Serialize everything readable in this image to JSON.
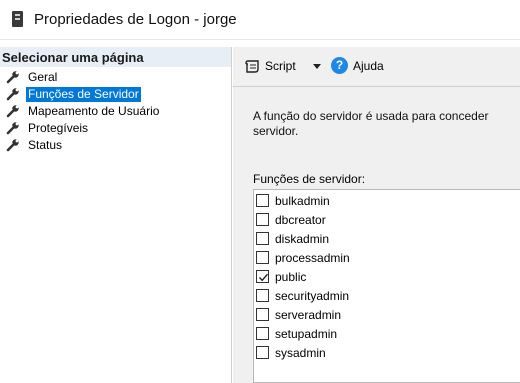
{
  "window": {
    "title": "Propriedades de Logon - jorge",
    "icon": "server-icon"
  },
  "sidebar": {
    "heading": "Selecionar uma página",
    "items": [
      {
        "label": "Geral",
        "icon": "wrench-icon",
        "selected": false
      },
      {
        "label": "Funções de Servidor",
        "icon": "wrench-icon",
        "selected": true
      },
      {
        "label": "Mapeamento de Usuário",
        "icon": "wrench-icon",
        "selected": false
      },
      {
        "label": "Protegíveis",
        "icon": "wrench-icon",
        "selected": false
      },
      {
        "label": "Status",
        "icon": "wrench-icon",
        "selected": false
      }
    ]
  },
  "toolbar": {
    "script_label": "Script",
    "help_label": "Ajuda",
    "help_glyph": "?"
  },
  "main": {
    "description_line1": "A função do servidor é usada para conceder",
    "description_line2": "servidor.",
    "roles_label": "Funções de servidor:",
    "roles": [
      {
        "label": "bulkadmin",
        "checked": false
      },
      {
        "label": "dbcreator",
        "checked": false
      },
      {
        "label": "diskadmin",
        "checked": false
      },
      {
        "label": "processadmin",
        "checked": false
      },
      {
        "label": "public",
        "checked": true
      },
      {
        "label": "securityadmin",
        "checked": false
      },
      {
        "label": "serveradmin",
        "checked": false
      },
      {
        "label": "setupadmin",
        "checked": false
      },
      {
        "label": "sysadmin",
        "checked": false
      }
    ]
  },
  "colors": {
    "selection": "#0078d7",
    "help_icon": "#1e88e5",
    "sidebar_heading_bg": "#e8eef6",
    "panel_bg": "#f0f0f0"
  }
}
